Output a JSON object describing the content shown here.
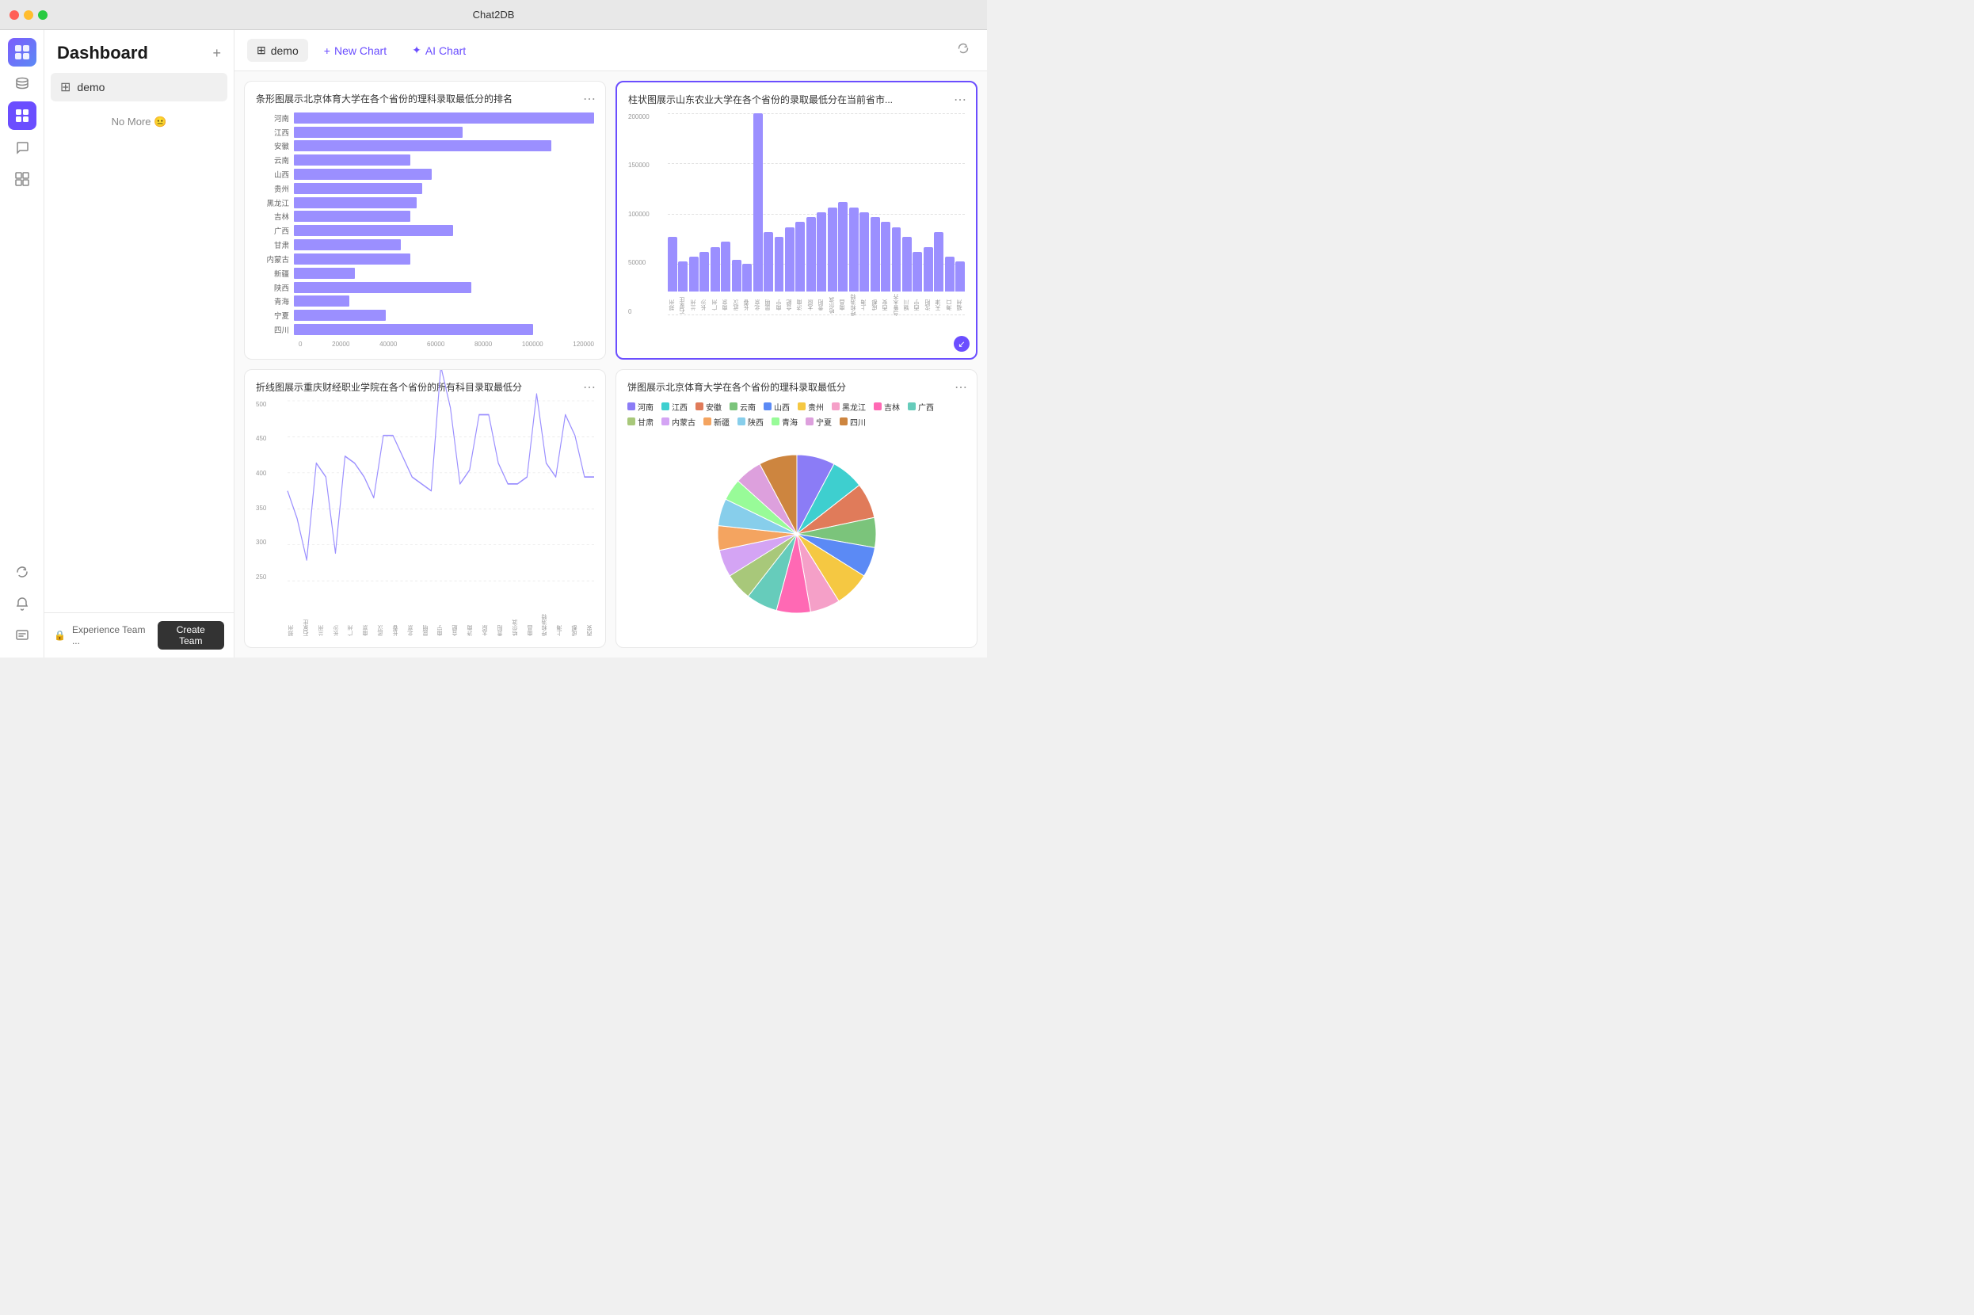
{
  "titlebar": {
    "title": "Chat2DB"
  },
  "topbar": {
    "tab_icon": "⊞",
    "tab_label": "demo",
    "new_chart_label": "New Chart",
    "ai_chart_label": "AI Chart"
  },
  "sidebar": {
    "title": "Dashboard",
    "nav_items": [
      {
        "icon": "⊞",
        "label": "demo",
        "active": true
      }
    ],
    "no_more_text": "No More 😐",
    "bottom": {
      "team_text": "Experience Team ...",
      "create_btn": "Create Team"
    }
  },
  "charts": [
    {
      "id": "chart1",
      "title": "条形图展示北京体育大学在各个省份的理科录取最低分的排名",
      "type": "bar_horizontal",
      "highlighted": false,
      "bars": [
        {
          "label": "河南",
          "value": 98
        },
        {
          "label": "江西",
          "value": 55
        },
        {
          "label": "安徽",
          "value": 84
        },
        {
          "label": "云南",
          "value": 38
        },
        {
          "label": "山西",
          "value": 45
        },
        {
          "label": "贵州",
          "value": 42
        },
        {
          "label": "黑龙江",
          "value": 40
        },
        {
          "label": "吉林",
          "value": 38
        },
        {
          "label": "广西",
          "value": 52
        },
        {
          "label": "甘肃",
          "value": 35
        },
        {
          "label": "内蒙古",
          "value": 38
        },
        {
          "label": "新疆",
          "value": 20
        },
        {
          "label": "陕西",
          "value": 58
        },
        {
          "label": "青海",
          "value": 18
        },
        {
          "label": "宁夏",
          "value": 30
        },
        {
          "label": "四川",
          "value": 78
        }
      ],
      "x_labels": [
        "0",
        "20000",
        "40000",
        "60000",
        "80000",
        "100000",
        "120000"
      ]
    },
    {
      "id": "chart2",
      "title": "柱状图展示山东农业大学在各个省份的录取最低分在当前省市...",
      "type": "bar_vertical",
      "highlighted": true,
      "y_labels": [
        "0",
        "50000",
        "100000",
        "150000",
        "200000"
      ],
      "bars": [
        55,
        30,
        35,
        40,
        45,
        50,
        32,
        28,
        180,
        60,
        55,
        65,
        70,
        75,
        80,
        85,
        90,
        85,
        80,
        75,
        70,
        65,
        55,
        40,
        45,
        60,
        35,
        30
      ],
      "x_labels": [
        "郑州",
        "石家庄",
        "兰州",
        "长沙",
        "广州",
        "南京",
        "武汉",
        "长春",
        "北京",
        "昆明",
        "南宁",
        "合肥",
        "济南",
        "太原",
        "贵阳",
        "哈尔滨",
        "南昌",
        "呼和浩特",
        "上海",
        "成都",
        "西安",
        "乌鲁木齐",
        "银川",
        "西宁",
        "沈阳",
        "天津",
        "海口",
        "福州"
      ]
    },
    {
      "id": "chart3",
      "title": "折线图展示重庆财经职业学院在各个省份的所有科目录取最低分",
      "type": "line",
      "y_labels": [
        "250",
        "300",
        "350",
        "400",
        "450",
        "500"
      ],
      "points": [
        380,
        340,
        280,
        420,
        400,
        290,
        430,
        420,
        400,
        370,
        460,
        460,
        430,
        400,
        390,
        380,
        560,
        500,
        390,
        410,
        490,
        490,
        420,
        390,
        390,
        400,
        520,
        420,
        400,
        490,
        460,
        400,
        400
      ],
      "x_labels": [
        "郑州",
        "石家庄",
        "兰州",
        "长沙",
        "广州",
        "南京",
        "武汉",
        "长春",
        "北京",
        "昆明",
        "南宁",
        "合肥",
        "济南",
        "太原",
        "贵阳",
        "哈尔滨",
        "南昌",
        "呼和浩特",
        "上海",
        "成都",
        "西安"
      ]
    },
    {
      "id": "chart4",
      "title": "饼图展示北京体育大学在各个省份的理科录取最低分",
      "type": "pie",
      "legend": [
        {
          "label": "河南",
          "color": "#8B7CF6"
        },
        {
          "label": "江西",
          "color": "#3ECFCF"
        },
        {
          "label": "安徽",
          "color": "#E07B5A"
        },
        {
          "label": "云南",
          "color": "#7BC47B"
        },
        {
          "label": "山西",
          "color": "#5B8AF5"
        },
        {
          "label": "贵州",
          "color": "#F5C842"
        },
        {
          "label": "黑龙江",
          "color": "#F5A0C8"
        },
        {
          "label": "吉林",
          "color": "#FF69B4"
        },
        {
          "label": "广西",
          "color": "#66CCBB"
        },
        {
          "label": "甘肃",
          "color": "#A8C87A"
        },
        {
          "label": "内蒙古",
          "color": "#D4A4F4"
        },
        {
          "label": "新疆",
          "color": "#F4A460"
        },
        {
          "label": "陕西",
          "color": "#87CEEB"
        },
        {
          "label": "青海",
          "color": "#98FB98"
        },
        {
          "label": "宁夏",
          "color": "#DDA0DD"
        },
        {
          "label": "四川",
          "color": "#CD853F"
        }
      ],
      "slices": [
        {
          "color": "#8B7CF6",
          "startAngle": 0,
          "endAngle": 28
        },
        {
          "color": "#3ECFCF",
          "startAngle": 28,
          "endAngle": 52
        },
        {
          "color": "#E07B5A",
          "startAngle": 52,
          "endAngle": 78
        },
        {
          "color": "#7BC47B",
          "startAngle": 78,
          "endAngle": 100
        },
        {
          "color": "#5B8AF5",
          "startAngle": 100,
          "endAngle": 122
        },
        {
          "color": "#F5C842",
          "startAngle": 122,
          "endAngle": 148
        },
        {
          "color": "#F5A0C8",
          "startAngle": 148,
          "endAngle": 170
        },
        {
          "color": "#FF69B4",
          "startAngle": 170,
          "endAngle": 195
        },
        {
          "color": "#66CCBB",
          "startAngle": 195,
          "endAngle": 218
        },
        {
          "color": "#A8C87A",
          "startAngle": 218,
          "endAngle": 238
        },
        {
          "color": "#D4A4F4",
          "startAngle": 238,
          "endAngle": 258
        },
        {
          "color": "#F4A460",
          "startAngle": 258,
          "endAngle": 276
        },
        {
          "color": "#87CEEB",
          "startAngle": 276,
          "endAngle": 296
        },
        {
          "color": "#98FB98",
          "startAngle": 296,
          "endAngle": 312
        },
        {
          "color": "#DDA0DD",
          "startAngle": 312,
          "endAngle": 332
        },
        {
          "color": "#CD853F",
          "startAngle": 332,
          "endAngle": 360
        }
      ]
    }
  ]
}
